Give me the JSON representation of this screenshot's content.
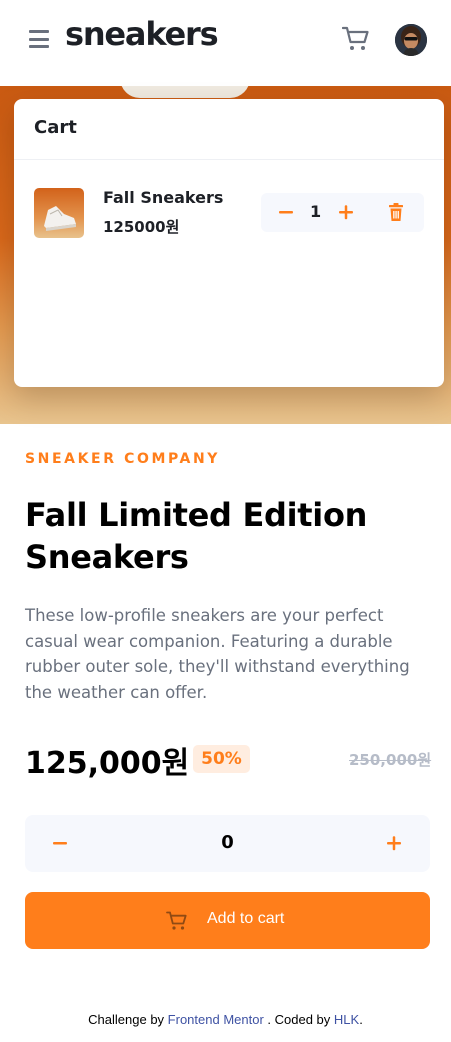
{
  "header": {
    "logo": "sneakers",
    "icons": {
      "menu": "hamburger-menu-icon",
      "cart": "cart-icon",
      "avatar": "avatar"
    }
  },
  "cart": {
    "title": "Cart",
    "item": {
      "name": "Fall Sneakers",
      "price": "125000원",
      "quantity": "1"
    }
  },
  "product": {
    "company": "SNEAKER COMPANY",
    "title": "Fall Limited Edition Sneakers",
    "description": "These low-profile sneakers are your perfect casual wear companion. Featuring a durable rubber outer sole, they'll withstand everything the weather can offer.",
    "price": "125,000원",
    "discount": "50%",
    "original_price": "250,000원"
  },
  "stepper": {
    "quantity": "0"
  },
  "add_to_cart": {
    "label": "Add to cart"
  },
  "footer": {
    "prefix": "Challenge by",
    "mentor_link": "Frontend Mentor",
    "middle": ". Coded by",
    "author_link": "HLK",
    "suffix": "."
  },
  "colors": {
    "accent": "#ff7e1b",
    "accent_light": "#ffede0",
    "text_dark": "#1d2026",
    "text_muted": "#69707d",
    "stepper_bg": "#f6f8fd"
  }
}
